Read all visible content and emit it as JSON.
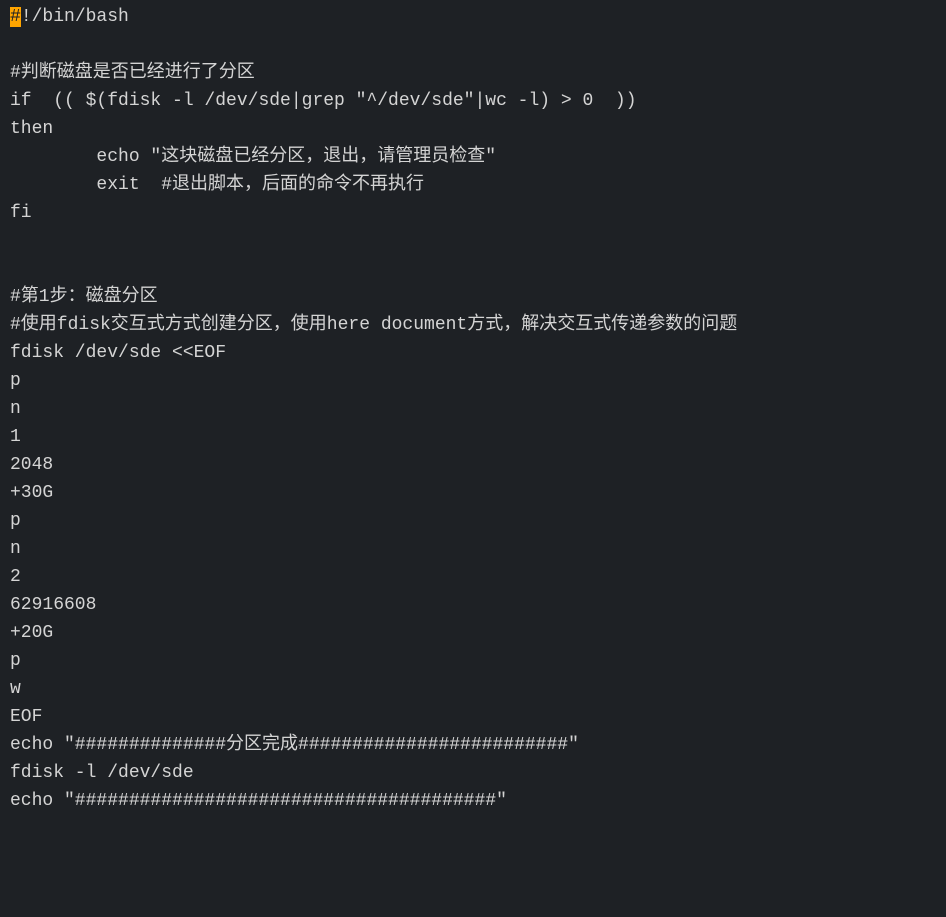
{
  "lines": [
    {
      "type": "shebang",
      "highlighted": "#",
      "rest": "!/bin/bash"
    },
    {
      "type": "blank",
      "text": ""
    },
    {
      "type": "comment",
      "text": "#判断磁盘是否已经进行了分区"
    },
    {
      "type": "code",
      "text": "if  (( $(fdisk -l /dev/sde|grep \"^/dev/sde\"|wc -l) > 0  ))"
    },
    {
      "type": "code",
      "text": "then"
    },
    {
      "type": "code",
      "text": "        echo \"这块磁盘已经分区，退出，请管理员检查\""
    },
    {
      "type": "code",
      "text": "        exit  #退出脚本，后面的命令不再执行"
    },
    {
      "type": "code",
      "text": "fi"
    },
    {
      "type": "blank",
      "text": ""
    },
    {
      "type": "blank",
      "text": ""
    },
    {
      "type": "comment",
      "text": "#第1步：磁盘分区"
    },
    {
      "type": "comment",
      "text": "#使用fdisk交互式方式创建分区，使用here document方式，解决交互式传递参数的问题"
    },
    {
      "type": "code",
      "text": "fdisk /dev/sde <<EOF"
    },
    {
      "type": "code",
      "text": "p"
    },
    {
      "type": "code",
      "text": "n"
    },
    {
      "type": "code",
      "text": "1"
    },
    {
      "type": "code",
      "text": "2048"
    },
    {
      "type": "code",
      "text": "+30G"
    },
    {
      "type": "code",
      "text": "p"
    },
    {
      "type": "code",
      "text": "n"
    },
    {
      "type": "code",
      "text": "2"
    },
    {
      "type": "code",
      "text": "62916608"
    },
    {
      "type": "code",
      "text": "+20G"
    },
    {
      "type": "code",
      "text": "p"
    },
    {
      "type": "code",
      "text": "w"
    },
    {
      "type": "code",
      "text": "EOF"
    },
    {
      "type": "code",
      "text": "echo \"##############分区完成#########################\""
    },
    {
      "type": "code",
      "text": "fdisk -l /dev/sde"
    },
    {
      "type": "code",
      "text": "echo \"#######################################\""
    }
  ]
}
